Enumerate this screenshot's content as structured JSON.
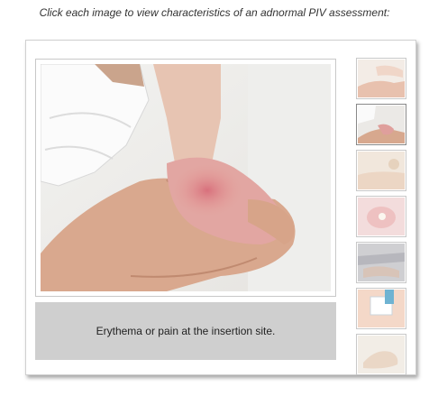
{
  "instruction": "Click each image to view characteristics of an adnormal PIV assessment:",
  "main_image": {
    "icon": "arm-erythema-photo"
  },
  "caption": "Erythema or pain at the insertion site.",
  "thumbnails": [
    {
      "icon": "thumbnail-1-arm-photo"
    },
    {
      "icon": "thumbnail-2-erythema-photo",
      "selected": true
    },
    {
      "icon": "thumbnail-3-photo"
    },
    {
      "icon": "thumbnail-4-drainage-photo"
    },
    {
      "icon": "thumbnail-5-photo"
    },
    {
      "icon": "thumbnail-6-dressing-photo"
    },
    {
      "icon": "thumbnail-7-photo"
    }
  ]
}
